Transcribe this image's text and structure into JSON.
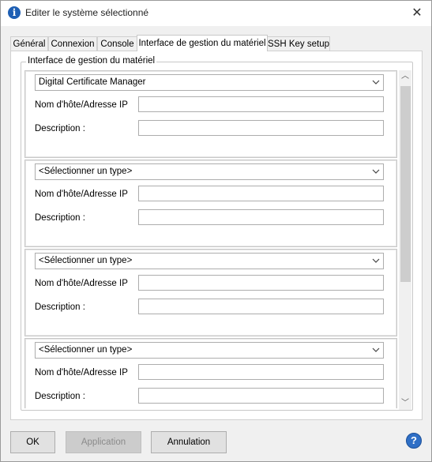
{
  "window": {
    "title": "Editer le système sélectionné"
  },
  "tabs": [
    {
      "label": "Général"
    },
    {
      "label": "Connexion"
    },
    {
      "label": "Console"
    },
    {
      "label": "Interface de gestion du matériel"
    },
    {
      "label": "SSH Key setup"
    }
  ],
  "active_tab": "Interface de gestion du matériel",
  "group": {
    "title": "Interface de gestion du matériel"
  },
  "items": [
    {
      "type": "Digital Certificate Manager",
      "host_label": "Nom d'hôte/Adresse IP",
      "host_value": "",
      "desc_label": "Description :",
      "desc_value": ""
    },
    {
      "type": "<Sélectionner un type>",
      "host_label": "Nom d'hôte/Adresse IP",
      "host_value": "",
      "desc_label": "Description :",
      "desc_value": ""
    },
    {
      "type": "<Sélectionner un type>",
      "host_label": "Nom d'hôte/Adresse IP",
      "host_value": "",
      "desc_label": "Description :",
      "desc_value": ""
    },
    {
      "type": "<Sélectionner un type>",
      "host_label": "Nom d'hôte/Adresse IP",
      "host_value": "",
      "desc_label": "Description :",
      "desc_value": ""
    }
  ],
  "buttons": {
    "ok": "OK",
    "apply": "Application",
    "cancel": "Annulation"
  },
  "icons": {
    "app": "info-icon",
    "close": "close-icon",
    "help": "help-icon",
    "dropdown": "chevron-down-icon"
  },
  "colors": {
    "accent": "#2f6fc6"
  }
}
